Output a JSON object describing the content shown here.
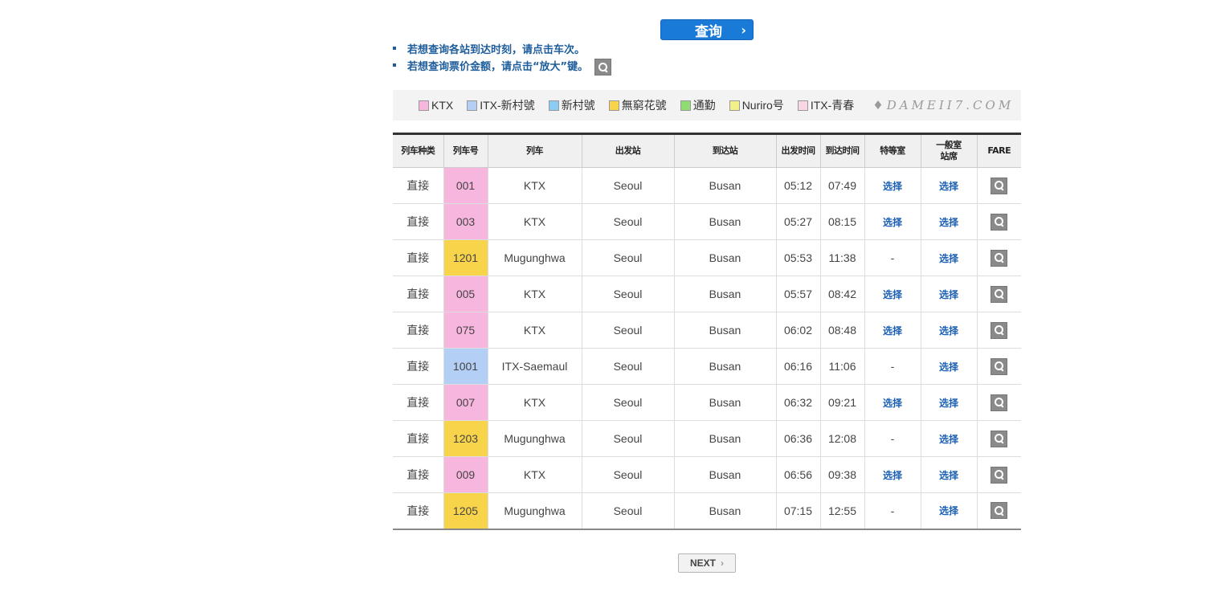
{
  "search_button": {
    "label": "查询",
    "chevron": "›"
  },
  "notes": [
    {
      "text": "若想查询各站到达时刻，请点击车次。"
    },
    {
      "text": "若想查询票价金额，请点击“放大”键。"
    }
  ],
  "legend": {
    "items": [
      {
        "label": "KTX",
        "color": "#f7b6de"
      },
      {
        "label": "ITX-新村號",
        "color": "#b4cff5"
      },
      {
        "label": "新村號",
        "color": "#8ccbf2"
      },
      {
        "label": "無窮花號",
        "color": "#f8d44a"
      },
      {
        "label": "通勤",
        "color": "#8fdc73"
      },
      {
        "label": "Nuriro号",
        "color": "#f3f08a"
      },
      {
        "label": "ITX-青春",
        "color": "#f9d6e4"
      }
    ],
    "watermark": "♦DAMEII7.COM"
  },
  "table": {
    "headers": {
      "type": "列车种类",
      "number": "列车号",
      "train": "列车",
      "departure_station": "出发站",
      "arrival_station": "到达站",
      "departure_time": "出发时间",
      "arrival_time": "到达时间",
      "first_class": "特等室",
      "standard_line1": "一般室",
      "standard_line2": "站席",
      "fare": "FARE"
    },
    "select_label": "选择",
    "no_seat": "-",
    "rows": [
      {
        "type": "直接",
        "number": "001",
        "train": "KTX",
        "from": "Seoul",
        "to": "Busan",
        "dep": "05:12",
        "arr": "07:49",
        "first_class": true,
        "color": "#f7b6de"
      },
      {
        "type": "直接",
        "number": "003",
        "train": "KTX",
        "from": "Seoul",
        "to": "Busan",
        "dep": "05:27",
        "arr": "08:15",
        "first_class": true,
        "color": "#f7b6de"
      },
      {
        "type": "直接",
        "number": "1201",
        "train": "Mugunghwa",
        "from": "Seoul",
        "to": "Busan",
        "dep": "05:53",
        "arr": "11:38",
        "first_class": false,
        "color": "#f8d44a"
      },
      {
        "type": "直接",
        "number": "005",
        "train": "KTX",
        "from": "Seoul",
        "to": "Busan",
        "dep": "05:57",
        "arr": "08:42",
        "first_class": true,
        "color": "#f7b6de"
      },
      {
        "type": "直接",
        "number": "075",
        "train": "KTX",
        "from": "Seoul",
        "to": "Busan",
        "dep": "06:02",
        "arr": "08:48",
        "first_class": true,
        "color": "#f7b6de"
      },
      {
        "type": "直接",
        "number": "1001",
        "train": "ITX-Saemaul",
        "from": "Seoul",
        "to": "Busan",
        "dep": "06:16",
        "arr": "11:06",
        "first_class": false,
        "color": "#b4cff5"
      },
      {
        "type": "直接",
        "number": "007",
        "train": "KTX",
        "from": "Seoul",
        "to": "Busan",
        "dep": "06:32",
        "arr": "09:21",
        "first_class": true,
        "color": "#f7b6de"
      },
      {
        "type": "直接",
        "number": "1203",
        "train": "Mugunghwa",
        "from": "Seoul",
        "to": "Busan",
        "dep": "06:36",
        "arr": "12:08",
        "first_class": false,
        "color": "#f8d44a"
      },
      {
        "type": "直接",
        "number": "009",
        "train": "KTX",
        "from": "Seoul",
        "to": "Busan",
        "dep": "06:56",
        "arr": "09:38",
        "first_class": true,
        "color": "#f7b6de"
      },
      {
        "type": "直接",
        "number": "1205",
        "train": "Mugunghwa",
        "from": "Seoul",
        "to": "Busan",
        "dep": "07:15",
        "arr": "12:55",
        "first_class": false,
        "color": "#f8d44a"
      }
    ]
  },
  "next_button": {
    "label": "NEXT",
    "chevron": "›"
  }
}
